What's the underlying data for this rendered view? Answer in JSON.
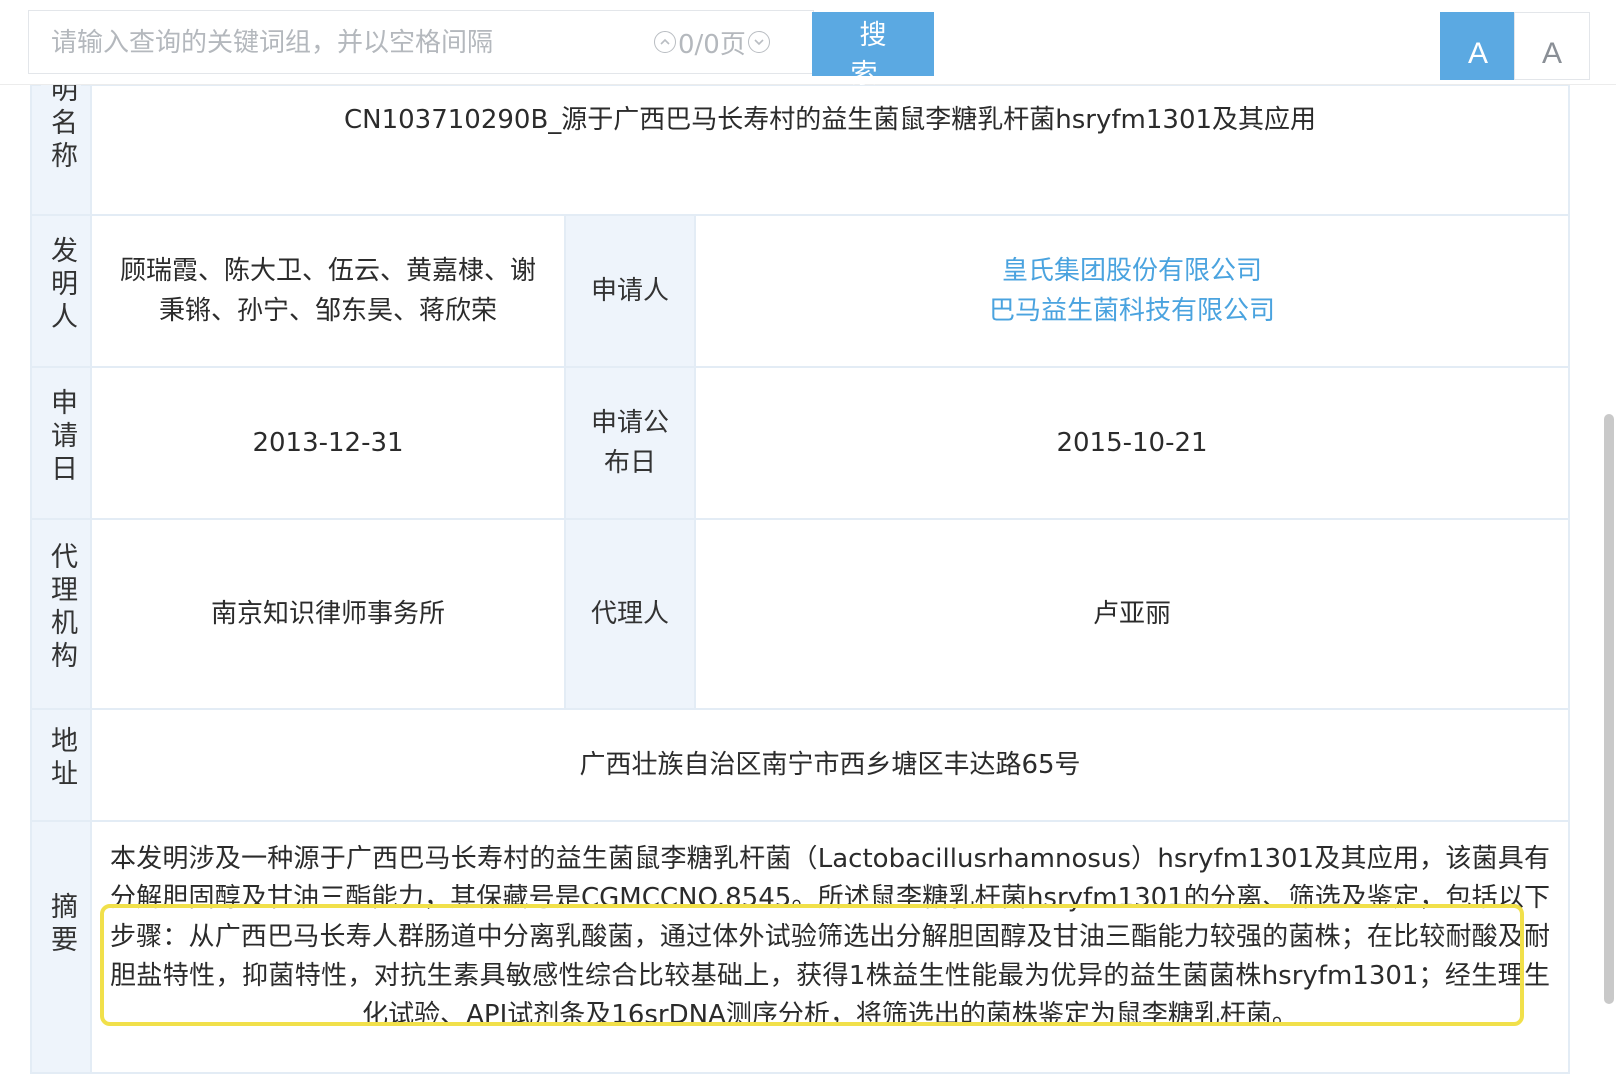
{
  "search": {
    "placeholder": "请输入查询的关键词组，并以空格间隔",
    "value": "",
    "page_count": "0/0页",
    "button_label": "搜 索"
  },
  "font_size": {
    "small_label": "A",
    "large_label": "A"
  },
  "colors": {
    "accent": "#5ba9e2",
    "link": "#4aa3df",
    "label_bg": "#eef4fb",
    "highlight": "#f1e04a"
  },
  "patent": {
    "title_label": "明名称",
    "title": "CN103710290B_源于广西巴马长寿村的益生菌鼠李糖乳杆菌hsryfm1301及其应用",
    "inventor_label": "发明人",
    "inventors": "顾瑞霞、陈大卫、伍云、黄嘉棣、谢秉锵、孙宁、邹东昊、蒋欣荣",
    "applicant_label": "申请人",
    "applicants": [
      "皇氏集团股份有限公司",
      "巴马益生菌科技有限公司"
    ],
    "application_date_label": "申请日",
    "application_date": "2013-12-31",
    "publication_date_label": "申请公布日",
    "publication_date": "2015-10-21",
    "agency_label": "代理机构",
    "agency": "南京知识律师事务所",
    "agent_label": "代理人",
    "agent": "卢亚丽",
    "address_label": "地址",
    "address": "广西壮族自治区南宁市西乡塘区丰达路65号",
    "abstract_label": "摘要",
    "abstract": "本发明涉及一种源于广西巴马长寿村的益生菌鼠李糖乳杆菌（Lactobacillusrhamnosus）hsryfm1301及其应用，该菌具有分解胆固醇及甘油三酯能力，其保藏号是CGMCCNO.8545。所述鼠李糖乳杆菌hsryfm1301的分离、筛选及鉴定，包括以下步骤：从广西巴马长寿人群肠道中分离乳酸菌，通过体外试验筛选出分解胆固醇及甘油三酯能力较强的菌株；在比较耐酸及耐胆盐特性，抑菌特性，对抗生素具敏感性综合比较基础上，获得1株益生性能最为优异的益生菌菌株hsryfm1301；经生理生化试验、API试剂条及16srDNA测序分析，将筛选出的菌株鉴定为鼠李糖乳杆菌。"
  }
}
